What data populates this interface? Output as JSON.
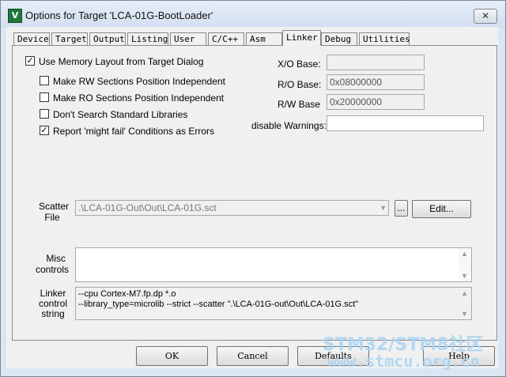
{
  "window": {
    "title": "Options for Target 'LCA-01G-BootLoader'",
    "close_glyph": "✕",
    "icon_glyph": "V"
  },
  "tabs": [
    {
      "label": "Device"
    },
    {
      "label": "Target"
    },
    {
      "label": "Output"
    },
    {
      "label": "Listing"
    },
    {
      "label": "User"
    },
    {
      "label": "C/C++"
    },
    {
      "label": "Asm"
    },
    {
      "label": "Linker",
      "active": true
    },
    {
      "label": "Debug"
    },
    {
      "label": "Utilities"
    }
  ],
  "linker": {
    "use_memory_layout": {
      "label": "Use Memory Layout from Target Dialog",
      "checked": true
    },
    "make_rw": {
      "label": "Make RW Sections Position Independent",
      "checked": false
    },
    "make_ro": {
      "label": "Make RO Sections Position Independent",
      "checked": false
    },
    "dont_search": {
      "label": "Don't Search Standard Libraries",
      "checked": false
    },
    "report_might_fail": {
      "label": "Report 'might fail' Conditions as Errors",
      "checked": true
    },
    "xo_base": {
      "label": "X/O Base:",
      "value": ""
    },
    "ro_base": {
      "label": "R/O Base:",
      "value": "0x08000000"
    },
    "rw_base": {
      "label": "R/W Base",
      "value": "0x20000000"
    },
    "disable_warnings": {
      "label": "disable Warnings:",
      "value": ""
    },
    "scatter": {
      "label_line1": "Scatter",
      "label_line2": "File",
      "value": ".\\LCA-01G-Out\\Out\\LCA-01G.sct",
      "browse_label": "...",
      "edit_label": "Edit..."
    },
    "misc": {
      "label_line1": "Misc",
      "label_line2": "controls",
      "value": ""
    },
    "control_string": {
      "label_line1": "Linker",
      "label_line2": "control",
      "label_line3": "string",
      "line1": "--cpu Cortex-M7.fp.dp *.o",
      "line2": "--library_type=microlib --strict --scatter \".\\LCA-01G-out\\Out\\LCA-01G.sct\""
    }
  },
  "buttons": {
    "ok": "OK",
    "cancel": "Cancel",
    "defaults": "Defaults",
    "help": "Help"
  },
  "watermark": {
    "line1": "STM32/STM8社区",
    "line2": "www.stmcu.org.cn"
  }
}
